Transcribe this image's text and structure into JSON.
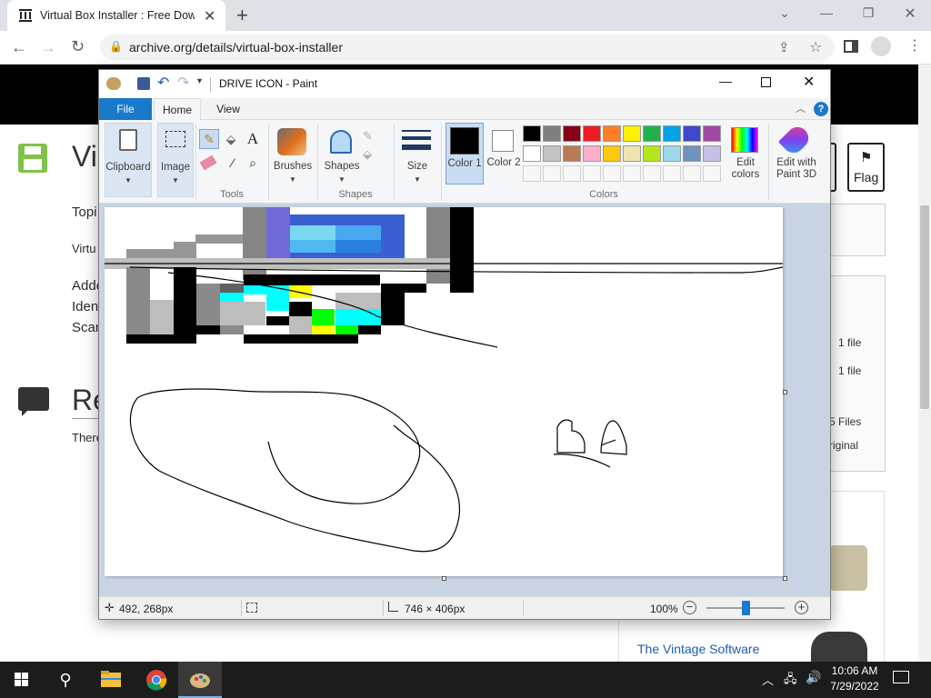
{
  "browser": {
    "tab_title": "Virtual Box Installer : Free Downlo",
    "new_tab": "+",
    "url": "archive.org/details/virtual-box-installer"
  },
  "site": {
    "title_fragment": "Vir",
    "topics_fragment": "Topi",
    "virtual_fragment": "Virtu",
    "added_fragment": "Adde",
    "ident_fragment": "Iden",
    "scan_fragment": "Scan",
    "reviews_fragment": "Re",
    "there_fragment": "There",
    "flag_label": "Flag",
    "files": [
      "1 file",
      "1 file"
    ],
    "files_total_fragment": "5 Files",
    "original_fragment": "riginal",
    "related_link": "The Vintage Software"
  },
  "paint": {
    "window_title": "DRIVE ICON - Paint",
    "tabs": [
      "File",
      "Home",
      "View"
    ],
    "ribbon": {
      "clipboard": "Clipboard",
      "image": "Image",
      "tools_group": "Tools",
      "brushes": "Brushes",
      "shapes": "Shapes",
      "shapes_group": "Shapes",
      "size": "Size",
      "color1": "Color 1",
      "color2": "Color 2",
      "colors_group": "Colors",
      "edit_colors": "Edit colors",
      "edit_paint3d": "Edit with Paint 3D"
    },
    "palette_row1": [
      "#000000",
      "#7f7f7f",
      "#880015",
      "#ed1c24",
      "#ff7f27",
      "#fff200",
      "#22b14c",
      "#00a2e8",
      "#3f48cc",
      "#a349a4"
    ],
    "palette_row2": [
      "#ffffff",
      "#c3c3c3",
      "#b97a57",
      "#ffaec9",
      "#ffc90e",
      "#efe4b0",
      "#b5e61d",
      "#99d9ea",
      "#7092be",
      "#c8bfe7"
    ],
    "status": {
      "cursor_pos": "492, 268px",
      "canvas_size": "746 × 406px",
      "zoom": "100%"
    }
  },
  "taskbar": {
    "time": "10:06 AM",
    "date": "7/29/2022"
  }
}
